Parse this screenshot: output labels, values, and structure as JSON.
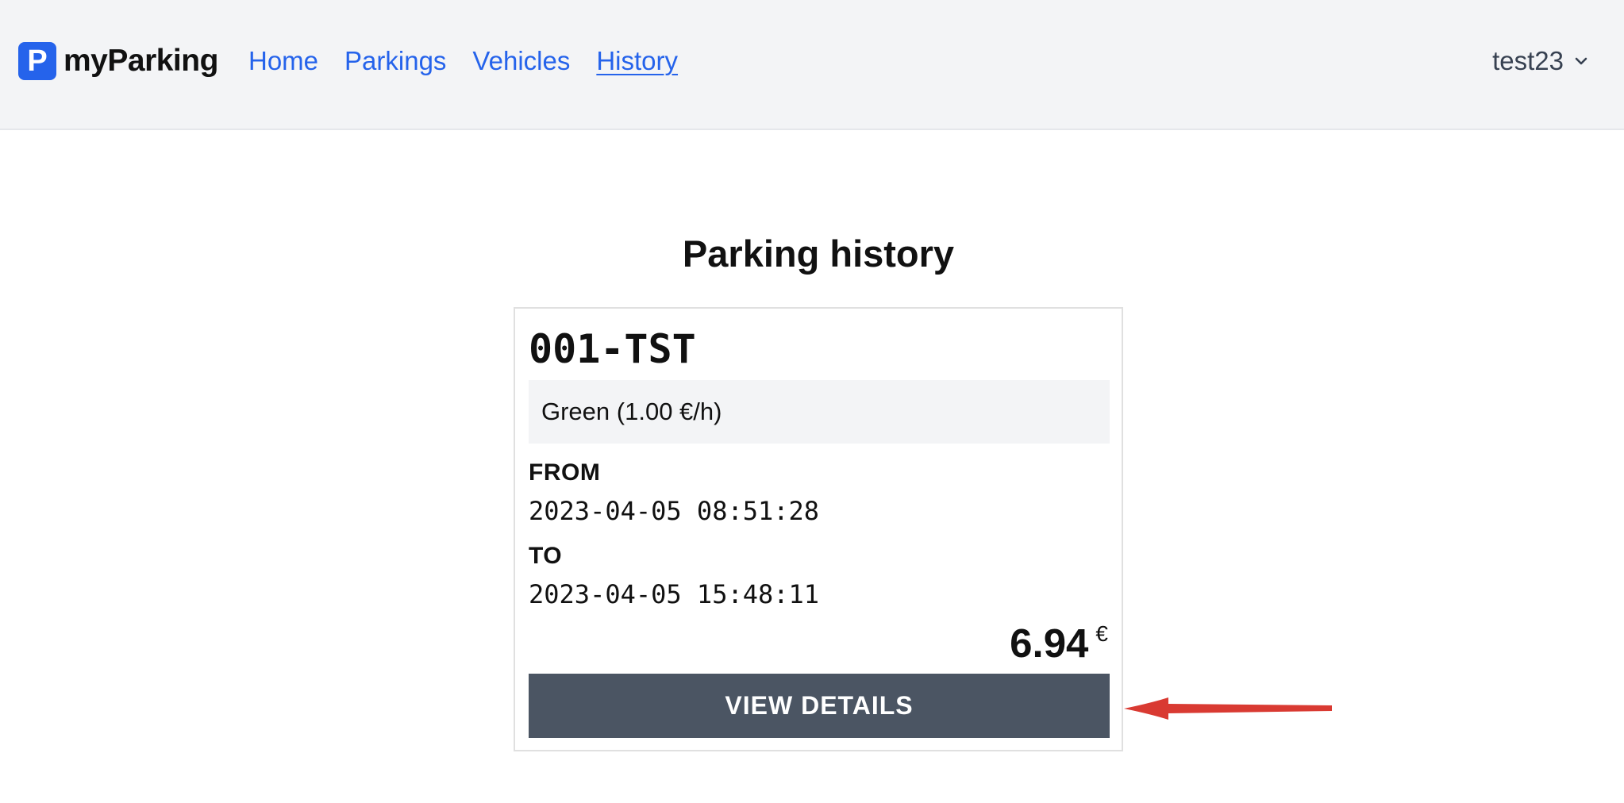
{
  "navbar": {
    "brand_logo_letter": "P",
    "brand_name": "myParking",
    "links": [
      {
        "label": "Home",
        "active": false
      },
      {
        "label": "Parkings",
        "active": false
      },
      {
        "label": "Vehicles",
        "active": false
      },
      {
        "label": "History",
        "active": true
      }
    ],
    "user_name": "test23",
    "user_menu_icon": "chevron-down-icon"
  },
  "page": {
    "title": "Parking history"
  },
  "history_card": {
    "plate": "001-TST",
    "zone": "Green (1.00 €/h)",
    "from_label": "FROM",
    "from_value": "2023-04-05 08:51:28",
    "to_label": "TO",
    "to_value": "2023-04-05 15:48:11",
    "price_amount": "6.94",
    "price_currency": "€",
    "details_button_label": "VIEW DETAILS"
  },
  "annotation": {
    "arrow_icon": "red-arrow-pointing-left",
    "arrow_color": "#d93a32"
  },
  "colors": {
    "brand_accent": "#2563eb",
    "navbar_bg": "#f3f4f6",
    "button_bg": "#4b5563",
    "zone_bg": "#f3f4f6"
  }
}
